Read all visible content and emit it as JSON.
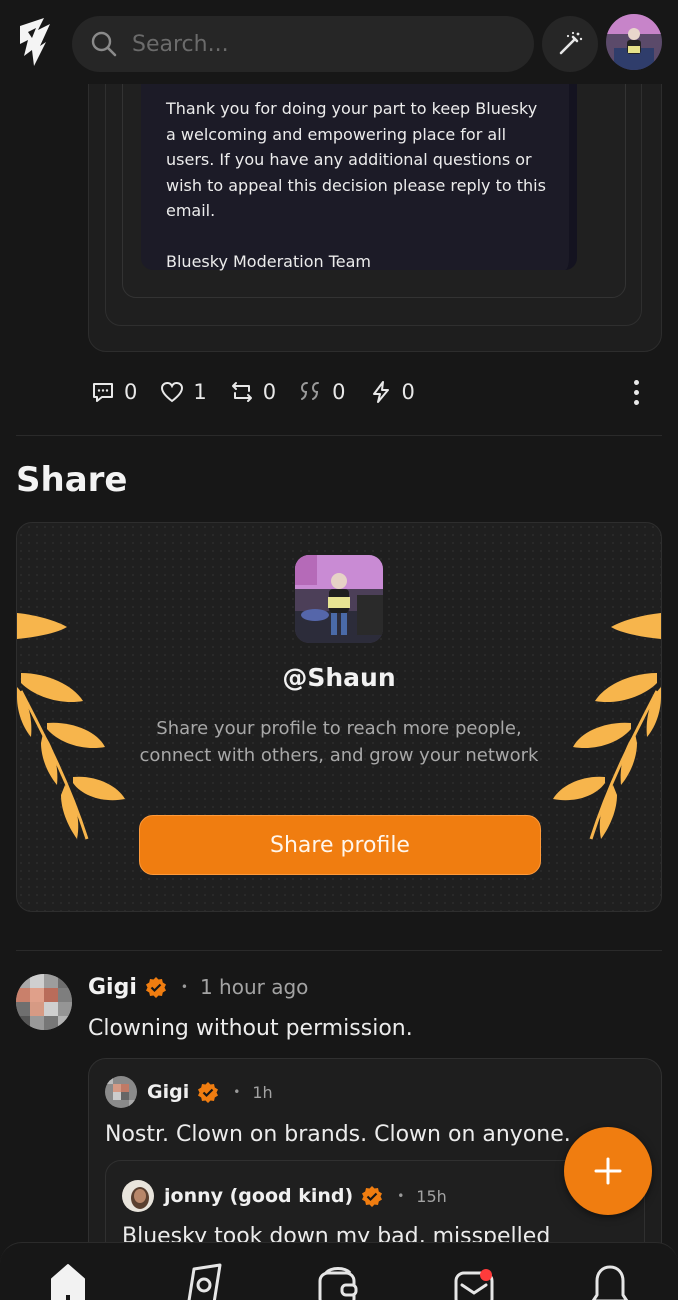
{
  "header": {
    "logo_icon": "app-logo-icon",
    "search_placeholder": "Search...",
    "compose_icon": "magic-wand-icon"
  },
  "email_quote": {
    "paragraph_1": "Thank you for doing your part to keep Bluesky a welcoming and empowering place for all users. If you have any additional questions or wish to appeal this decision please reply to this email.",
    "signature": "Bluesky Moderation Team"
  },
  "actions": {
    "replies": "0",
    "likes": "1",
    "reposts": "0",
    "quotes": "0",
    "zaps": "0"
  },
  "share": {
    "title": "Share",
    "handle": "@Shaun",
    "description": "Share your profile to reach more people, connect with others, and grow your network",
    "button_label": "Share profile",
    "accent": "#f07d10",
    "leaf_color": "#f7b54c"
  },
  "post": {
    "author": "Gigi",
    "time": "1 hour ago",
    "separator": "•",
    "text": "Clowning without permission.",
    "quote": {
      "author": "Gigi",
      "time": "1h",
      "text": "Nostr. Clown on brands. Clown on anyone."
    },
    "nested_quote": {
      "author": "jonny (good kind)",
      "time": "15h",
      "text": "Bluesky took down my bad, misspelled"
    }
  },
  "nav": {
    "items": [
      "home-icon",
      "explore-icon",
      "wallet-icon",
      "messages-icon",
      "notifications-icon"
    ]
  },
  "colors": {
    "background": "#171717",
    "verified_badge": "#f07d10",
    "unread_dot": "#ff3b3b"
  }
}
